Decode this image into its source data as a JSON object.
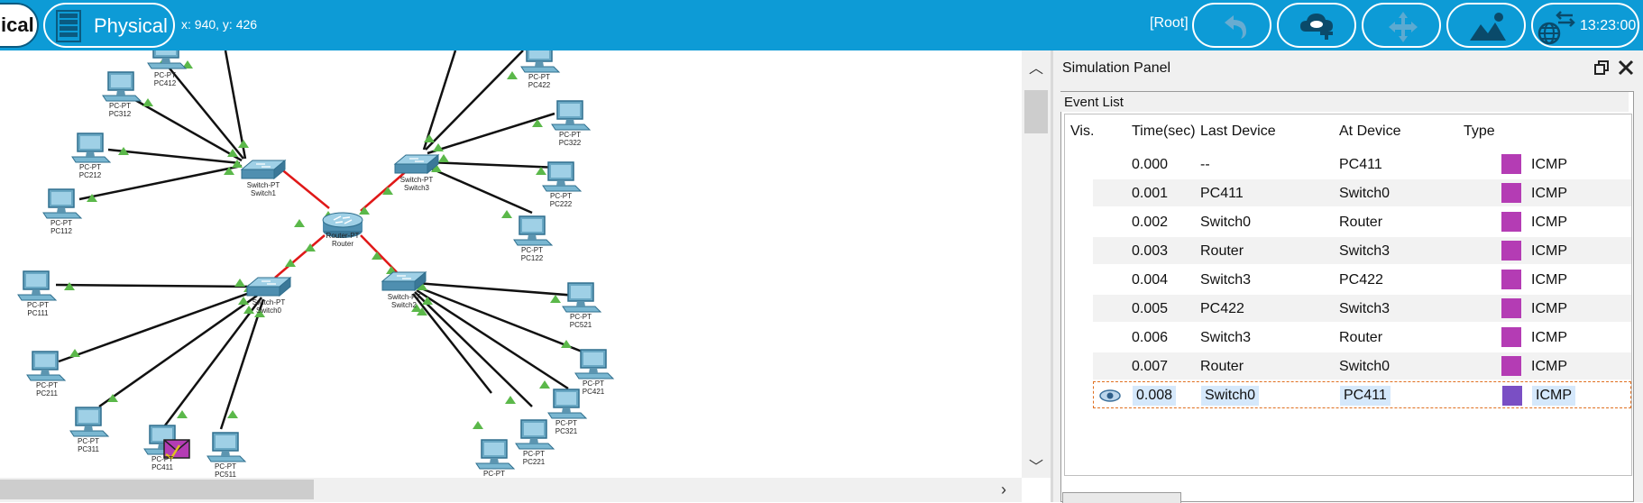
{
  "toolbar": {
    "logical_label": "ical",
    "physical_label": "Physical",
    "coordinates": "x: 940, y: 426",
    "root_label": "[Root]",
    "clock": "13:23:00",
    "accent_color": "#0d9bd6"
  },
  "topology": {
    "labels": {
      "pc412": "PC-PT\nPC412",
      "pc312": "PC-PT\nPC312",
      "pc212": "PC-PT\nPC212",
      "pc112": "PC-PT\nPC112",
      "pc111": "PC-PT\nPC111",
      "pc211": "PC-PT\nPC211",
      "pc311": "PC-PT\nPC311",
      "pc411": "PC-PT\nPC411",
      "pc511": "PC-PT\nPC511",
      "pc422": "PC-PT\nPC422",
      "pc322": "PC-PT\nPC322",
      "pc222": "PC-PT\nPC222",
      "pc122": "PC-PT\nPC122",
      "pc521": "PC-PT\nPC521",
      "pc421": "PC-PT\nPC421",
      "pc321": "PC-PT\nPC321",
      "pc221": "PC-PT\nPC221",
      "pc121": "PC-PT",
      "switch1": "Switch-PT\nSwitch1",
      "switch3": "Switch-PT\nSwitch3",
      "switch0": "Switch-PT\nSwitch0",
      "switch2": "Switch-PT\nSwitch2",
      "router": "Router-PT\nRouter"
    }
  },
  "panel": {
    "title": "Simulation Panel",
    "event_list_label": "Event List",
    "columns": [
      "Vis.",
      "Time(sec)",
      "Last Device",
      "At Device",
      "Type"
    ],
    "events": [
      {
        "time": "0.000",
        "last": "--",
        "at": "PC411",
        "type": "ICMP",
        "color": "#b43cb4"
      },
      {
        "time": "0.001",
        "last": "PC411",
        "at": "Switch0",
        "type": "ICMP",
        "color": "#b43cb4"
      },
      {
        "time": "0.002",
        "last": "Switch0",
        "at": "Router",
        "type": "ICMP",
        "color": "#b43cb4"
      },
      {
        "time": "0.003",
        "last": "Router",
        "at": "Switch3",
        "type": "ICMP",
        "color": "#b43cb4"
      },
      {
        "time": "0.004",
        "last": "Switch3",
        "at": "PC422",
        "type": "ICMP",
        "color": "#b43cb4"
      },
      {
        "time": "0.005",
        "last": "PC422",
        "at": "Switch3",
        "type": "ICMP",
        "color": "#b43cb4"
      },
      {
        "time": "0.006",
        "last": "Switch3",
        "at": "Router",
        "type": "ICMP",
        "color": "#b43cb4"
      },
      {
        "time": "0.007",
        "last": "Router",
        "at": "Switch0",
        "type": "ICMP",
        "color": "#b43cb4"
      },
      {
        "time": "0.008",
        "last": "Switch0",
        "at": "PC411",
        "type": "ICMP",
        "color": "#7a4fc4"
      }
    ]
  }
}
